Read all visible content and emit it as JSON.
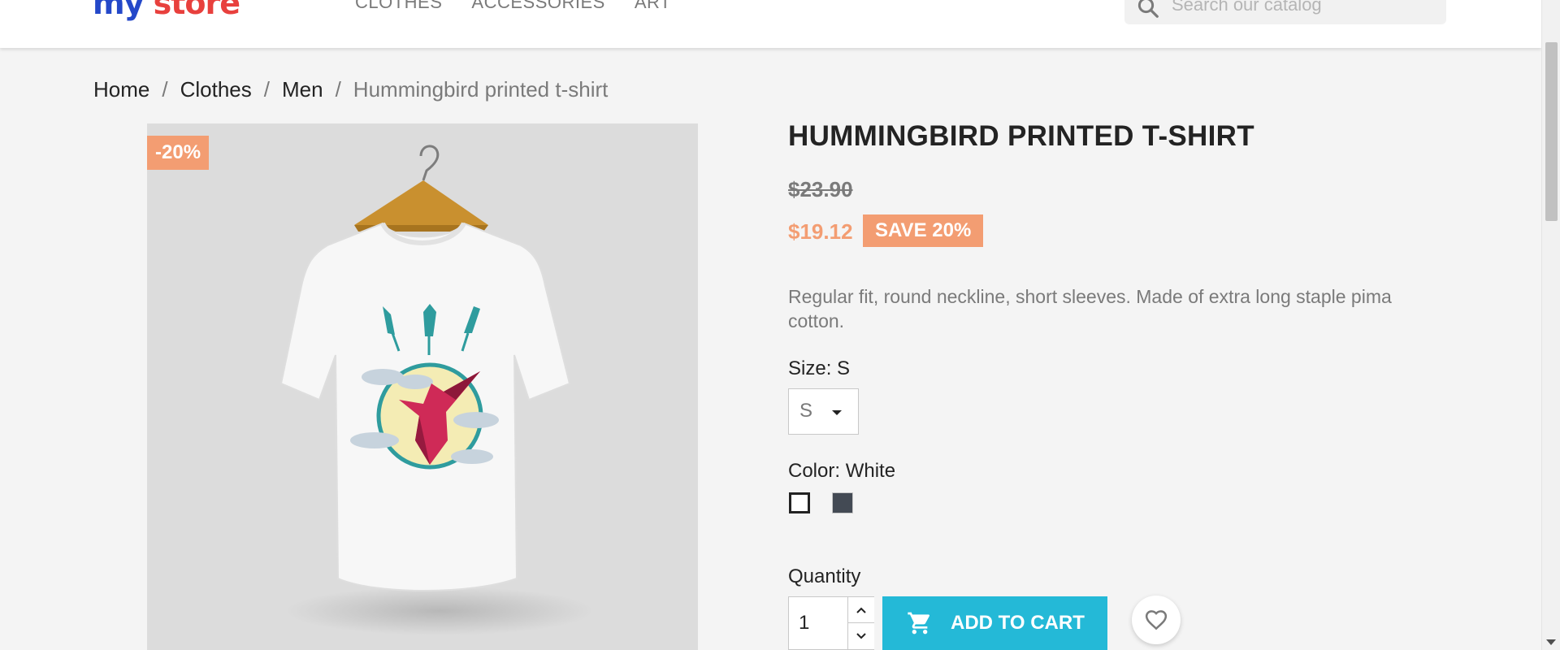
{
  "header": {
    "logo_part1": "my ",
    "logo_part2": "store",
    "nav": [
      "CLOTHES",
      "ACCESSORIES",
      "ART"
    ],
    "search_placeholder": "Search our catalog"
  },
  "breadcrumb": {
    "items": [
      "Home",
      "Clothes",
      "Men"
    ],
    "current": "Hummingbird printed t-shirt",
    "separator": "/"
  },
  "product": {
    "discount_flag": "-20%",
    "title": "HUMMINGBIRD PRINTED T-SHIRT",
    "regular_price": "$23.90",
    "price": "$19.12",
    "save_badge": "SAVE 20%",
    "description": "Regular fit, round neckline, short sleeves. Made of extra long staple pima cotton.",
    "size_label": "Size: S",
    "size_value": "S",
    "color_label": "Color: White",
    "colors": [
      {
        "name": "White",
        "hex": "#ffffff",
        "selected": true
      },
      {
        "name": "Grey",
        "hex": "#434a54",
        "selected": false
      }
    ],
    "quantity_label": "Quantity",
    "quantity_value": "1",
    "add_to_cart_label": "ADD TO CART"
  },
  "colors": {
    "accent": "#24b9d7",
    "sale": "#f39d72",
    "text": "#232323",
    "muted": "#7a7a7a"
  }
}
